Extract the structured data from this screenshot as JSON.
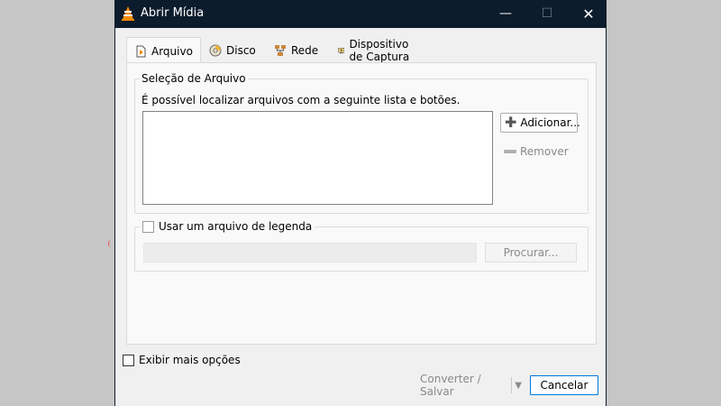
{
  "window": {
    "title": "Abrir Mídia",
    "controls": {
      "minimize": "—",
      "maximize": "☐",
      "close": "✕"
    }
  },
  "tabs": [
    {
      "label": "Arquivo",
      "icon": "file-icon",
      "active": true
    },
    {
      "label": "Disco",
      "icon": "disc-icon",
      "active": false
    },
    {
      "label": "Rede",
      "icon": "network-icon",
      "active": false
    },
    {
      "label": "Dispositivo de Captura",
      "icon": "capture-device-icon",
      "active": false
    }
  ],
  "file_selection": {
    "legend": "Seleção de Arquivo",
    "description": "É possível localizar arquivos com a seguinte lista e botões.",
    "add_label": "Adicionar...",
    "remove_label": "Remover",
    "files": []
  },
  "subtitle": {
    "checkbox_label": "Usar um arquivo de legenda",
    "checked": false,
    "path_value": "",
    "browse_label": "Procurar..."
  },
  "footer": {
    "more_options_label": "Exibir mais opções",
    "more_options_checked": false,
    "convert_label": "Converter / Salvar",
    "cancel_label": "Cancelar"
  },
  "colors": {
    "titlebar": "#0c1c2c",
    "accent": "#0078d7",
    "vlc_orange": "#f28a00"
  }
}
